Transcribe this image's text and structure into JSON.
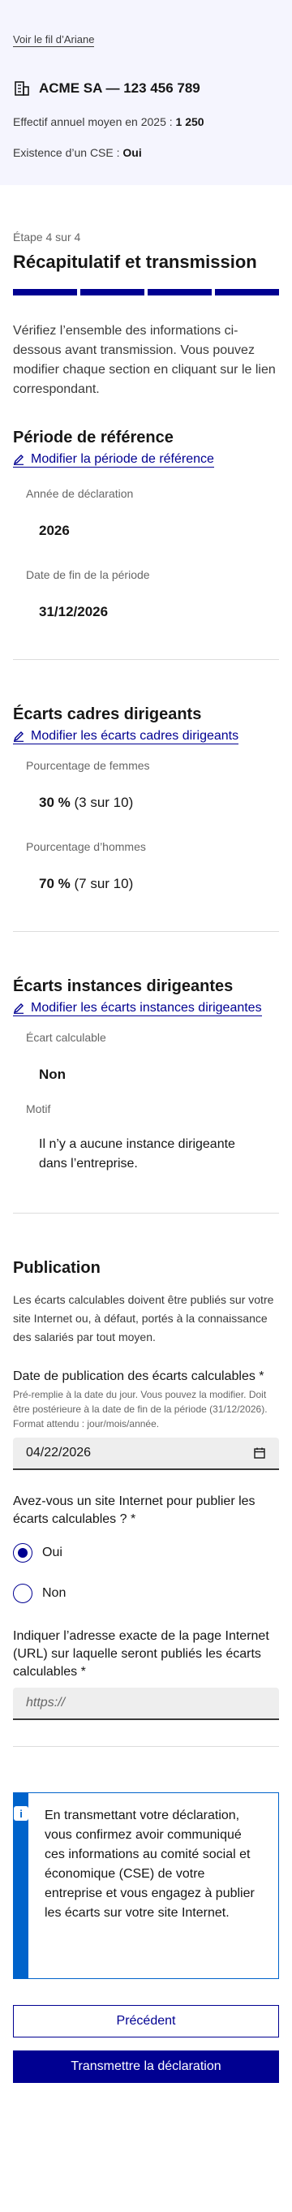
{
  "header": {
    "breadcrumb_toggle": "Voir le fil d’Ariane",
    "company_name": "ACME SA — 123 456 789",
    "headcount_label": "Effectif annuel moyen en 2025 :",
    "headcount_value": "1 250",
    "cse_label": "Existence d’un CSE :",
    "cse_value": "Oui"
  },
  "step": {
    "label": "Étape 4 sur 4",
    "title": "Récapitulatif et transmission",
    "intro": "Vérifiez l’ensemble des informations ci-dessous avant transmission. Vous pouvez modifier chaque section en cliquant sur le lien correspondant."
  },
  "period": {
    "title": "Période de référence",
    "edit_link": "Modifier la période de référence",
    "year_label": "Année de déclaration",
    "year_value": "2026",
    "end_label": "Date de fin de la période",
    "end_value": "31/12/2026"
  },
  "exec_gaps": {
    "title": "Écarts cadres dirigeants",
    "edit_link": "Modifier les écarts cadres dirigeants",
    "women_label": "Pourcentage de femmes",
    "women_value": "30 %",
    "women_detail": "(3 sur 10)",
    "men_label": "Pourcentage d’hommes",
    "men_value": "70 %",
    "men_detail": "(7 sur 10)"
  },
  "board_gaps": {
    "title": "Écarts instances dirigeantes",
    "edit_link": "Modifier les écarts instances dirigeantes",
    "calc_label": "Écart calculable",
    "calc_value": "Non",
    "reason_label": "Motif",
    "reason_value": "Il n’y a aucune instance dirigeante dans l’entreprise."
  },
  "publication": {
    "title": "Publication",
    "text": "Les écarts calculables doivent être publiés sur votre site Internet ou, à défaut, portés à la connaissance des salariés par tout moyen.",
    "date_label": "Date de publication des écarts calculables *",
    "date_hint": "Pré-remplie à la date du jour. Vous pouvez la modifier. Doit être postérieure à la date de fin de la période (31/12/2026). Format attendu : jour/mois/année.",
    "date_value": "04/22/2026",
    "website_question": "Avez-vous un site Internet pour publier les écarts calculables ? *",
    "option_yes": "Oui",
    "option_no": "Non",
    "url_label": "Indiquer l’adresse exacte de la page Internet (URL) sur laquelle seront publiés les écarts calculables *",
    "url_placeholder": "https://"
  },
  "notice": {
    "text": "En transmettant votre déclaration, vous confirmez avoir communiqué ces informations au comité social et économique (CSE) de votre entreprise et vous engagez à publier les écarts sur votre site Internet."
  },
  "actions": {
    "previous": "Précédent",
    "submit": "Transmettre la déclaration"
  },
  "colors": {
    "primary": "#000091",
    "info": "#0063cb",
    "topband": "#f5f5fe"
  }
}
